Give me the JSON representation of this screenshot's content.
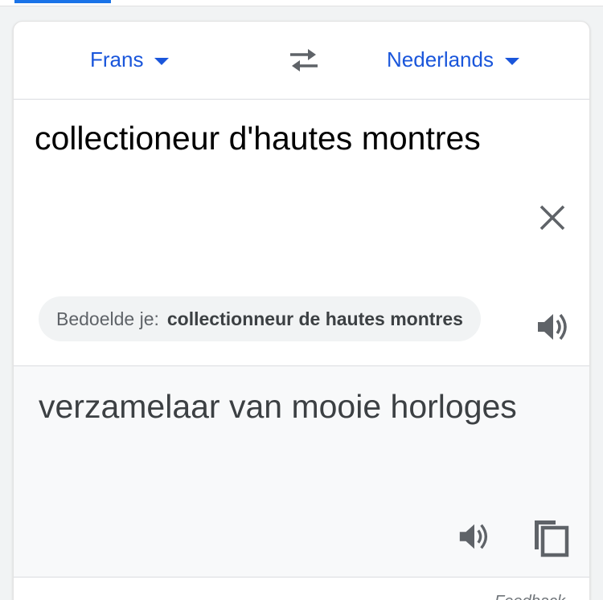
{
  "languages": {
    "source": "Frans",
    "target": "Nederlands"
  },
  "source": {
    "text": "collectioneur d'hautes montres",
    "suggestion_prefix": "Bedoelde je:",
    "suggestion_value": "collectionneur de hautes montres"
  },
  "target": {
    "text": "verzamelaar van mooie horloges"
  },
  "footer": {
    "feedback_label": "Feedback"
  },
  "icons": {
    "swap": "swap-languages-icon",
    "clear": "close-icon",
    "speak": "speaker-icon",
    "copy": "copy-icon"
  },
  "colors": {
    "accent": "#1a56db",
    "icon": "#5f6368"
  }
}
